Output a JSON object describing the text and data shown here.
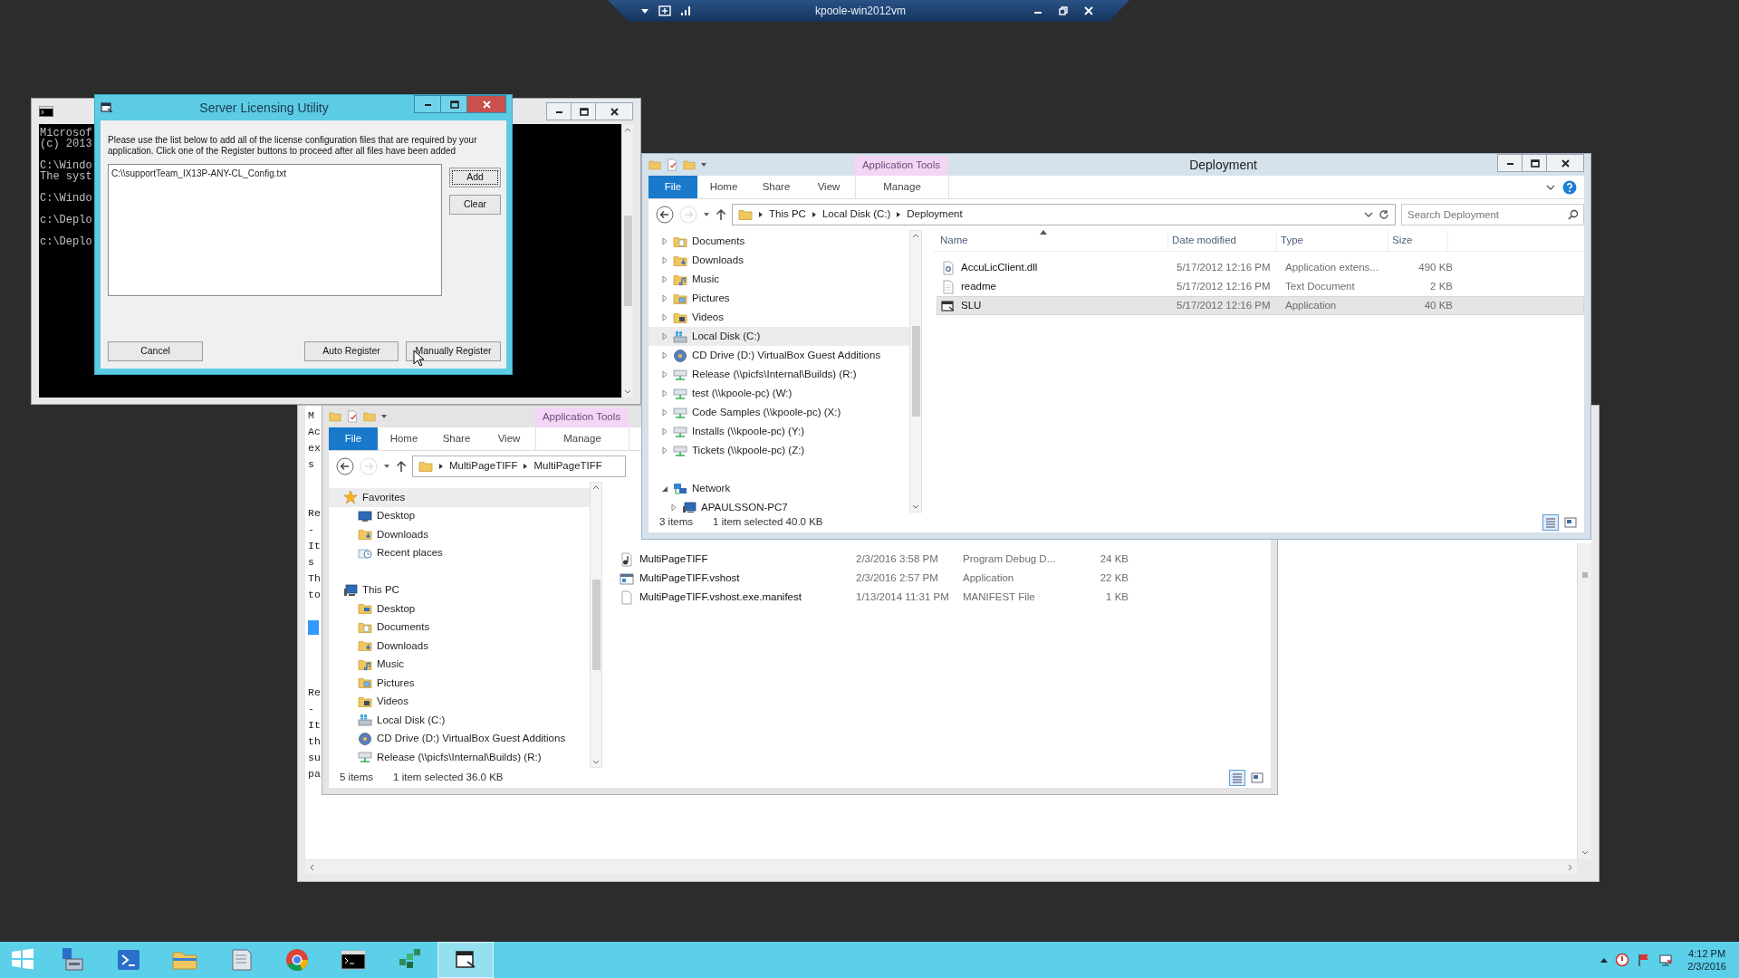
{
  "vm_bar": {
    "title": "kpoole-win2012vm"
  },
  "console": {
    "paragraphs": [
      [
        "Microsof",
        "(c) 2013"
      ],
      [
        "C:\\Windo",
        "The syst"
      ],
      [
        "C:\\Windo"
      ],
      [
        "c:\\Deplo"
      ],
      [
        "c:\\Deplo"
      ]
    ]
  },
  "licensing_dialog": {
    "title": "Server Licensing Utility",
    "instructions": "Please use the list below to add all of the license configuration files that are required by your application. Click one of the Register buttons to proceed after all files have been added",
    "files": [
      "C:\\\\supportTeam_IX13P-ANY-CL_Config.txt"
    ],
    "side_buttons": [
      {
        "label": "Add",
        "focused": true
      },
      {
        "label": "Clear",
        "focused": false
      }
    ],
    "bottom_buttons": [
      {
        "label": "Cancel",
        "focused": false
      },
      {
        "label": "Auto Register",
        "focused": false
      },
      {
        "label": "Manually Register",
        "focused": false
      }
    ]
  },
  "editor": {
    "lines": [
      {
        "kind": "text",
        "text": "M"
      },
      {
        "kind": "text",
        "text": "Ac"
      },
      {
        "kind": "text",
        "text": "ex"
      },
      {
        "kind": "text",
        "text": "s"
      },
      {
        "kind": "blank"
      },
      {
        "kind": "blank"
      },
      {
        "kind": "text",
        "text": "Re"
      },
      {
        "kind": "text",
        "text": "-"
      },
      {
        "kind": "text",
        "text": "It"
      },
      {
        "kind": "text",
        "text": "s"
      },
      {
        "kind": "text",
        "text": "Th"
      },
      {
        "kind": "text",
        "text": "to"
      },
      {
        "kind": "blank"
      },
      {
        "kind": "selection"
      },
      {
        "kind": "blank"
      },
      {
        "kind": "blank"
      },
      {
        "kind": "blank"
      },
      {
        "kind": "text",
        "text": "Re"
      },
      {
        "kind": "text",
        "text": "-"
      },
      {
        "kind": "text",
        "text": "It"
      },
      {
        "kind": "text",
        "text": "th"
      },
      {
        "kind": "text",
        "text": "su"
      },
      {
        "kind": "text",
        "text": "pa"
      }
    ]
  },
  "tiff_explorer": {
    "context_tab": "Application Tools",
    "ribbon_tabs": [
      {
        "label": "File",
        "kind": "file"
      },
      {
        "label": "Home",
        "kind": "tab"
      },
      {
        "label": "Share",
        "kind": "tab"
      },
      {
        "label": "View",
        "kind": "tab"
      },
      {
        "label": "Manage",
        "kind": "context"
      }
    ],
    "breadcrumbs": [
      "MultiPageTIFF",
      "MultiPageTIFF"
    ],
    "nav": [
      {
        "label": "Favorites",
        "kind": "star",
        "highlighted": true,
        "children": [
          {
            "label": "Desktop",
            "kind": "monitor",
            "highlighted": false
          },
          {
            "label": "Downloads",
            "kind": "downloads",
            "highlighted": false
          },
          {
            "label": "Recent places",
            "kind": "recent",
            "highlighted": false
          }
        ]
      },
      {
        "label": "This PC",
        "kind": "computer",
        "highlighted": false,
        "children": [
          {
            "label": "Desktop",
            "kind": "desktop",
            "highlighted": false
          },
          {
            "label": "Documents",
            "kind": "documents",
            "highlighted": false
          },
          {
            "label": "Downloads",
            "kind": "downloads",
            "highlighted": false
          },
          {
            "label": "Music",
            "kind": "music",
            "highlighted": false
          },
          {
            "label": "Pictures",
            "kind": "pictures",
            "highlighted": false
          },
          {
            "label": "Videos",
            "kind": "videos",
            "highlighted": false
          },
          {
            "label": "Local Disk (C:)",
            "kind": "disk",
            "highlighted": false
          },
          {
            "label": "CD Drive (D:) VirtualBox Guest Additions",
            "kind": "cd",
            "highlighted": false
          },
          {
            "label": "Release (\\\\picfs\\Internal\\Builds) (R:)",
            "kind": "netdrive",
            "highlighted": false
          }
        ]
      }
    ],
    "files": [
      {
        "name": "MultiPageTIFF",
        "date": "2/3/2016 3:58 PM",
        "type": "Program Debug D...",
        "size": "24 KB",
        "kind": "pdb",
        "selected": false
      },
      {
        "name": "MultiPageTIFF.vshost",
        "date": "2/3/2016 2:57 PM",
        "type": "Application",
        "size": "22 KB",
        "kind": "exe",
        "selected": false
      },
      {
        "name": "MultiPageTIFF.vshost.exe.manifest",
        "date": "1/13/2014 11:31 PM",
        "type": "MANIFEST File",
        "size": "1 KB",
        "kind": "blank",
        "selected": false
      }
    ],
    "status": {
      "count": "5 items",
      "selection": "1 item selected  36.0 KB"
    }
  },
  "deployment_explorer": {
    "title": "Deployment",
    "context_tab": "Application Tools",
    "ribbon_tabs": [
      {
        "label": "File",
        "kind": "file"
      },
      {
        "label": "Home",
        "kind": "tab"
      },
      {
        "label": "Share",
        "kind": "tab"
      },
      {
        "label": "View",
        "kind": "tab"
      },
      {
        "label": "Manage",
        "kind": "context"
      }
    ],
    "breadcrumbs": [
      "This PC",
      "Local Disk (C:)",
      "Deployment"
    ],
    "search": {
      "placeholder": "Search Deployment"
    },
    "nav": [
      {
        "label": "Documents",
        "kind": "documents",
        "expanded": false,
        "highlighted": false
      },
      {
        "label": "Downloads",
        "kind": "downloads",
        "expanded": false,
        "highlighted": false
      },
      {
        "label": "Music",
        "kind": "music",
        "expanded": false,
        "highlighted": false
      },
      {
        "label": "Pictures",
        "kind": "pictures",
        "expanded": false,
        "highlighted": false
      },
      {
        "label": "Videos",
        "kind": "videos",
        "expanded": false,
        "highlighted": false
      },
      {
        "label": "Local Disk (C:)",
        "kind": "disk",
        "expanded": false,
        "highlighted": true
      },
      {
        "label": "CD Drive (D:) VirtualBox Guest Additions",
        "kind": "cd",
        "expanded": false,
        "highlighted": false
      },
      {
        "label": "Release (\\\\picfs\\Internal\\Builds) (R:)",
        "kind": "netdrive",
        "expanded": false,
        "highlighted": false
      },
      {
        "label": "test (\\\\kpoole-pc) (W:)",
        "kind": "netdrive",
        "expanded": false,
        "highlighted": false
      },
      {
        "label": "Code Samples (\\\\kpoole-pc) (X:)",
        "kind": "netdrive",
        "expanded": false,
        "highlighted": false
      },
      {
        "label": "Installs (\\\\kpoole-pc) (Y:)",
        "kind": "netdrive",
        "expanded": false,
        "highlighted": false
      },
      {
        "label": "Tickets (\\\\kpoole-pc) (Z:)",
        "kind": "netdrive",
        "expanded": false,
        "highlighted": false
      },
      {
        "label": "Network",
        "kind": "network",
        "expanded": true,
        "highlighted": false,
        "children": [
          {
            "label": "APAULSSON-PC7",
            "kind": "computer",
            "expanded": false,
            "highlighted": false
          }
        ]
      }
    ],
    "columns": [
      "Name",
      "Date modified",
      "Type",
      "Size"
    ],
    "files": [
      {
        "name": "AccuLicClient.dll",
        "date": "5/17/2012 12:16 PM",
        "type": "Application extens...",
        "size": "490 KB",
        "kind": "dll",
        "selected": false
      },
      {
        "name": "readme",
        "date": "5/17/2012 12:16 PM",
        "type": "Text Document",
        "size": "2 KB",
        "kind": "text",
        "selected": false
      },
      {
        "name": "SLU",
        "date": "5/17/2012 12:16 PM",
        "type": "Application",
        "size": "40 KB",
        "kind": "app",
        "selected": true
      }
    ],
    "status": {
      "count": "3 items",
      "selection": "1 item selected  40.0 KB"
    }
  },
  "taskbar": {
    "apps": [
      {
        "kind": "start",
        "selected": false
      },
      {
        "kind": "server",
        "selected": false
      },
      {
        "kind": "shell",
        "selected": false
      },
      {
        "kind": "explorer",
        "selected": false
      },
      {
        "kind": "notepad",
        "selected": false
      },
      {
        "kind": "browser",
        "selected": false
      },
      {
        "kind": "cmd",
        "selected": false
      },
      {
        "kind": "blocks",
        "selected": false
      },
      {
        "kind": "window",
        "selected": true
      }
    ],
    "clock": {
      "time": "4:12 PM",
      "date": "2/3/2016"
    }
  }
}
